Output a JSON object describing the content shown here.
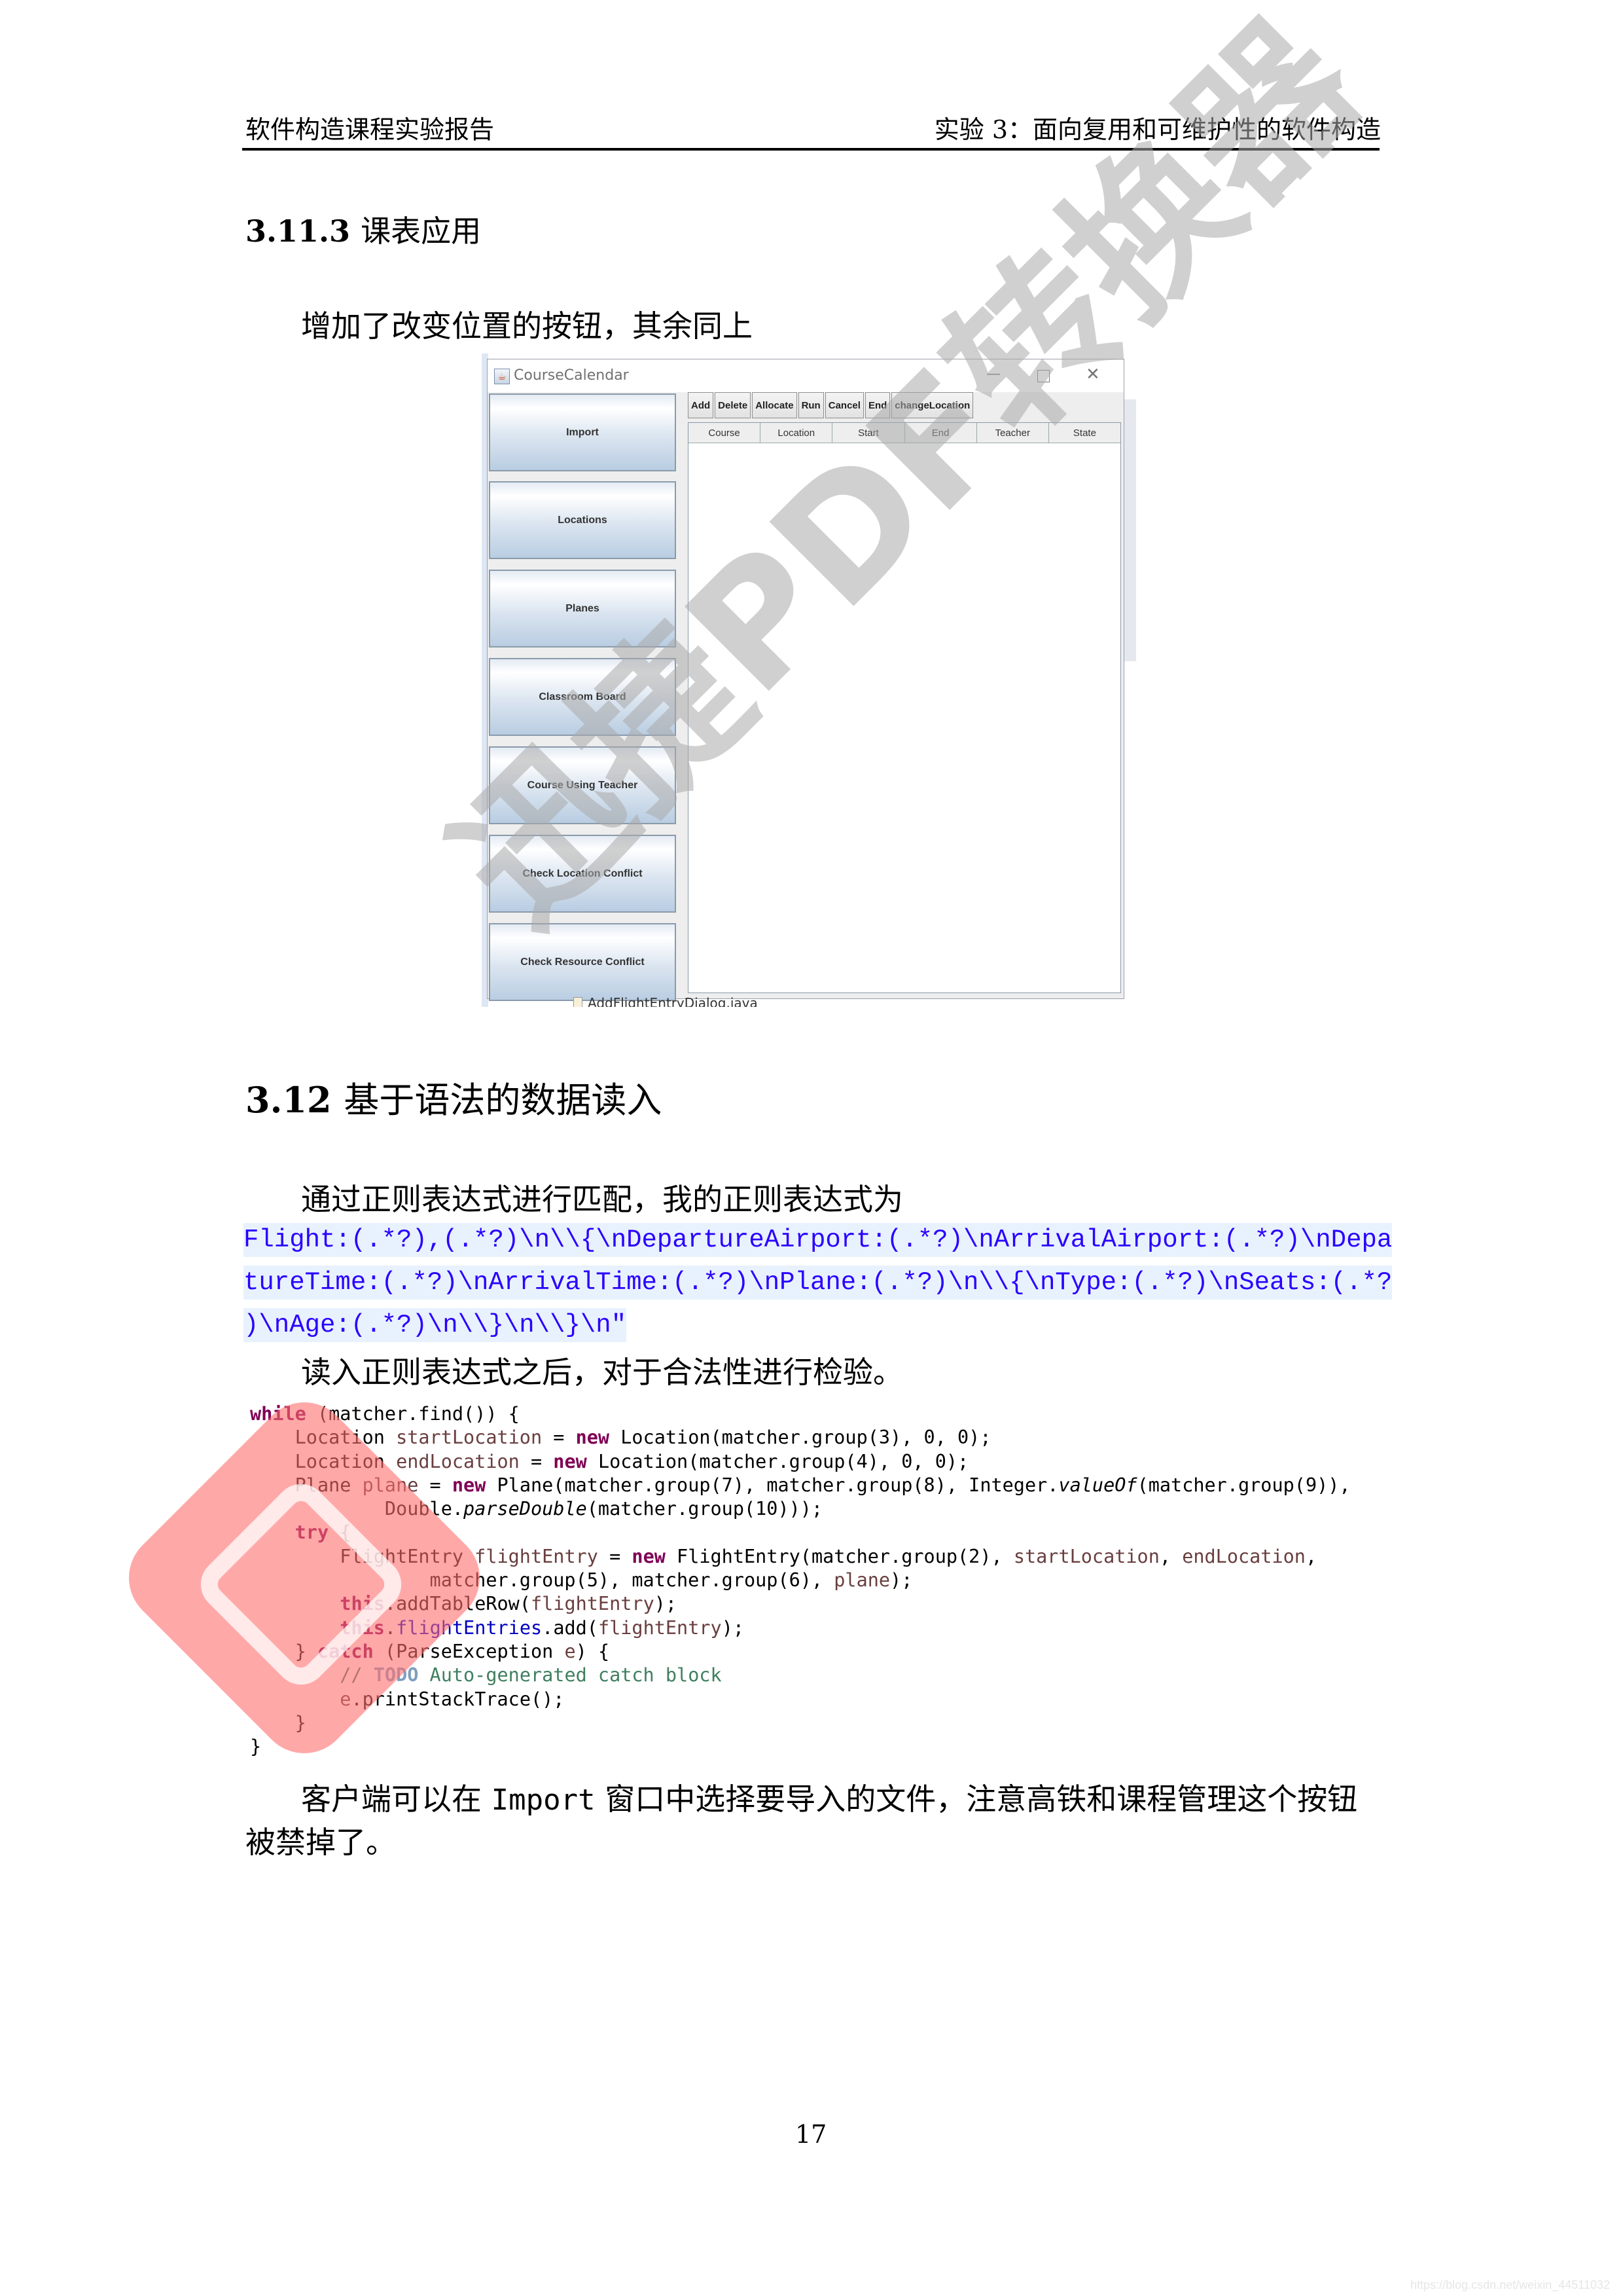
{
  "header": {
    "left": "软件构造课程实验报告",
    "right": "实验 3：面向复用和可维护性的软件构造"
  },
  "section_3_11_3": {
    "number": "3.11.3",
    "title": "课表应用",
    "paragraph": "增加了改变位置的按钮，其余同上"
  },
  "screenshot": {
    "window_title": "CourseCalendar",
    "window_icon": "java-cup-icon",
    "controls": {
      "minimize": "—",
      "maximize": "☐",
      "close": "✕"
    },
    "side_buttons": [
      "Import",
      "Locations",
      "Planes",
      "Classroom Board",
      "Course Using Teacher",
      "Check Location Conflict",
      "Check Resource Conflict"
    ],
    "toolbar_buttons": [
      "Add",
      "Delete",
      "Allocate",
      "Run",
      "Cancel",
      "End",
      "changeLocation"
    ],
    "table_columns": [
      "Course",
      "Location",
      "Start",
      "End",
      "Teacher",
      "State"
    ],
    "table_rows": [],
    "background_file": "AddFlightEntryDialog.java"
  },
  "section_3_12": {
    "number": "3.12",
    "title": "基于语法的数据读入",
    "intro": "通过正则表达式进行匹配，我的正则表达式为",
    "regex_lines": [
      "Flight:(.*?),(.*?)\\n\\\\{\\nDepartureAirport:(.*?)\\nArrivalAirport:(.*?)\\nDepa",
      "tureTime:(.*?)\\nArrivalTime:(.*?)\\nPlane:(.*?)\\n\\\\{\\nType:(.*?)\\nSeats:(.*?",
      ")\\nAge:(.*?)\\n\\\\}\\n\\\\}\\n\""
    ],
    "after_regex": "读入正则表达式之后，对于合法性进行检验。",
    "code": {
      "l1_kw": "while",
      "l1_rest": " (matcher.find()) {",
      "l2": [
        "    Location ",
        "startLocation",
        " = ",
        "new",
        " Location(matcher.group(3), 0, 0);"
      ],
      "l3": [
        "    Location ",
        "endLocation",
        " = ",
        "new",
        " Location(matcher.group(4), 0, 0);"
      ],
      "l4": [
        "    Plane ",
        "plane",
        " = ",
        "new",
        " Plane(matcher.group(7), matcher.group(8), Integer.",
        "valueOf",
        "(matcher.group(9)),"
      ],
      "l5": [
        "            Double.",
        "parseDouble",
        "(matcher.group(10)));"
      ],
      "l6": [
        "    ",
        "try",
        " {"
      ],
      "l7": [
        "        FlightEntry ",
        "flightEntry",
        " = ",
        "new",
        " FlightEntry(matcher.group(2), ",
        "startLocation",
        ", ",
        "endLocation",
        ","
      ],
      "l8": [
        "                matcher.group(5), matcher.group(6), ",
        "plane",
        ");"
      ],
      "l9": [
        "        ",
        "this",
        ".addTableRow(",
        "flightEntry",
        ");"
      ],
      "l10": [
        "        ",
        "this",
        ".",
        "flightEntries",
        ".add(",
        "flightEntry",
        ");"
      ],
      "l11": [
        "    } ",
        "catch",
        " (ParseException ",
        "e",
        ") {"
      ],
      "l12": [
        "        // ",
        "TODO",
        " Auto-generated catch block"
      ],
      "l13": [
        "        ",
        "e",
        ".printStackTrace();"
      ],
      "l14": "    }",
      "l15": "}"
    },
    "closing_pre": "客户端可以在 ",
    "closing_mono": "Import",
    "closing_post": " 窗口中选择要导入的文件，注意高铁和课程管理这个按钮被禁掉了。"
  },
  "page_number": "17",
  "watermark_text": "迅捷PDF转换器",
  "source_url": "https://blog.csdn.net/weixin_44511032"
}
